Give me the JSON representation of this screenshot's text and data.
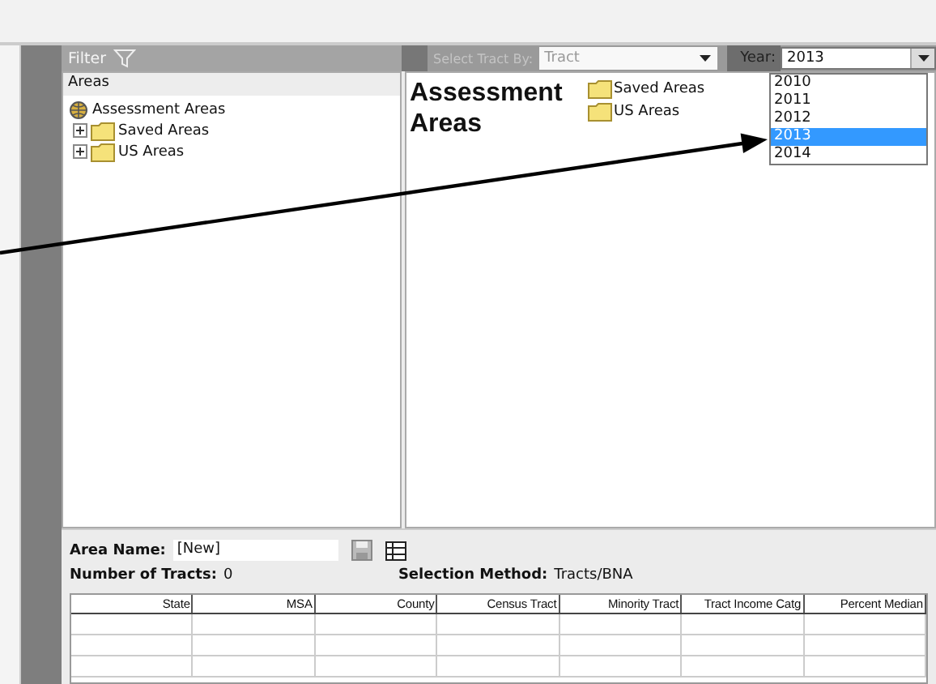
{
  "filter": {
    "title": "Filter"
  },
  "toolbar": {
    "tract_label": "Select Tract By:",
    "tract_value": "Tract",
    "tract_disabled": true,
    "year_label": "Year:",
    "year_value": "2013",
    "year_open": true,
    "year_options": [
      {
        "label": "2010",
        "selected": false
      },
      {
        "label": "2011",
        "selected": false
      },
      {
        "label": "2012",
        "selected": false
      },
      {
        "label": "2013",
        "selected": true
      },
      {
        "label": "2014",
        "selected": false
      }
    ]
  },
  "tree": {
    "header": "Areas",
    "root": {
      "label": "Assessment Areas",
      "children": [
        {
          "label": "Saved Areas",
          "expanded": false
        },
        {
          "label": "US Areas",
          "expanded": false
        }
      ]
    }
  },
  "content": {
    "title": "Assessment Areas",
    "folders": [
      "Saved Areas",
      "US Areas"
    ]
  },
  "area": {
    "name_label": "Area Name:",
    "name_value": "[New]",
    "tracts_label": "Number of Tracts:",
    "tracts_value": "0",
    "method_label": "Selection Method:",
    "method_value": "Tracts/BNA"
  },
  "table": {
    "columns": [
      "State",
      "MSA",
      "County",
      "Census Tract",
      "Minority Tract",
      "Tract Income Catg",
      "Percent Median"
    ]
  }
}
